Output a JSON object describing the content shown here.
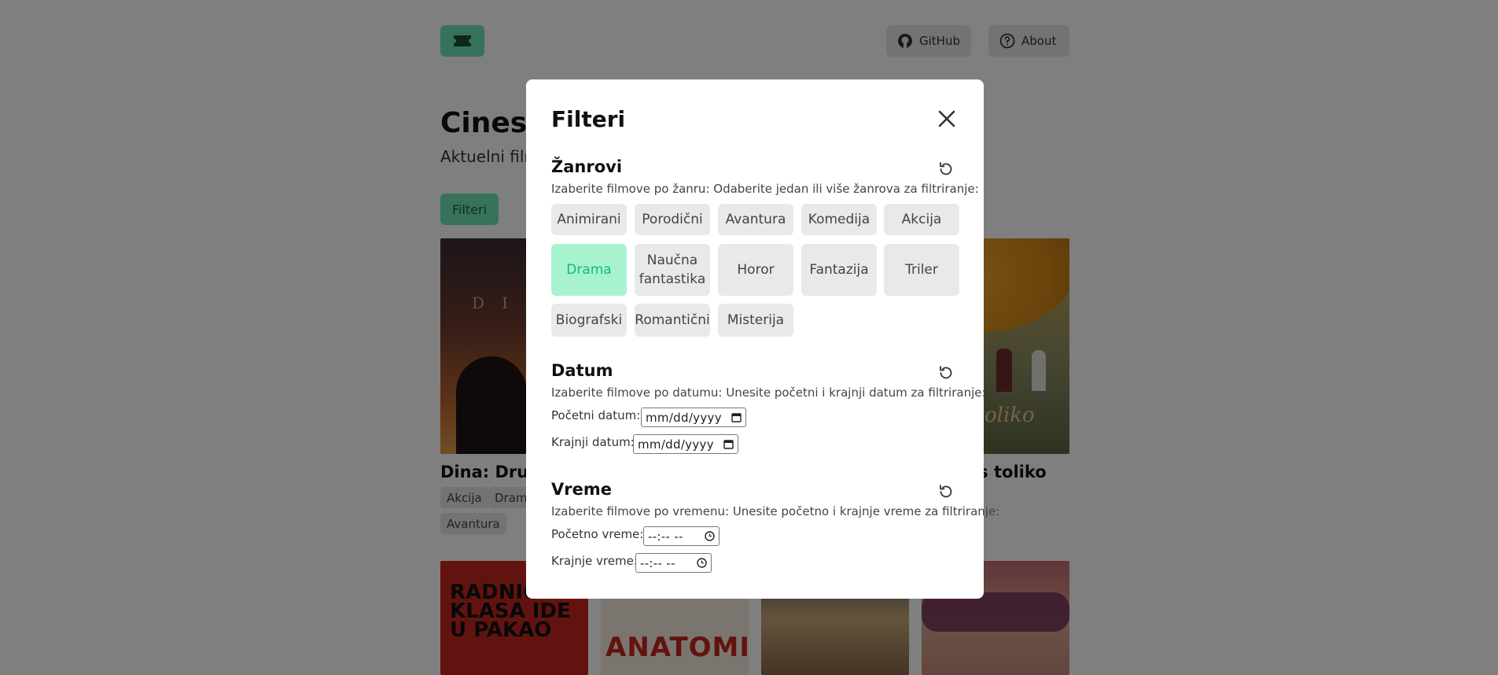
{
  "background": {
    "nav": {
      "github_label": "GitHub",
      "about_label": "About"
    },
    "page_title": "Cinesk",
    "page_subtitle": "Aktuelni film",
    "filter_button_label": "Filteri",
    "movies": [
      {
        "title": "Dina: Drugi",
        "tags": [
          "Akcija",
          "Dram",
          "Avantura"
        ]
      },
      {
        "title": "as toliko"
      }
    ],
    "poster_texts": {
      "radnicka": "RADNIČKA KLASA IDE U PAKAO",
      "anatomija": "ANATOMIJA",
      "ras": "ras toliko"
    }
  },
  "modal": {
    "title": "Filteri",
    "genres_section": {
      "title": "Žanrovi",
      "description": "Izaberite filmove po žanru: Odaberite jedan ili više žanrova za filtriranje:",
      "items": [
        {
          "label": "Animirani",
          "selected": false
        },
        {
          "label": "Porodični",
          "selected": false
        },
        {
          "label": "Avantura",
          "selected": false
        },
        {
          "label": "Komedija",
          "selected": false
        },
        {
          "label": "Akcija",
          "selected": false
        },
        {
          "label": "Drama",
          "selected": true
        },
        {
          "label": "Naučna fantastika",
          "selected": false
        },
        {
          "label": "Horor",
          "selected": false
        },
        {
          "label": "Fantazija",
          "selected": false
        },
        {
          "label": "Triler",
          "selected": false
        },
        {
          "label": "Biografski",
          "selected": false
        },
        {
          "label": "Romantični",
          "selected": false
        },
        {
          "label": "Misterija",
          "selected": false
        }
      ]
    },
    "date_section": {
      "title": "Datum",
      "description": "Izaberite filmove po datumu: Unesite početni i krajnji datum za filtriranje:",
      "start_label": "Početni datum:",
      "start_placeholder": "mm/dd/yyyy",
      "end_label": "Krajnji datum:",
      "end_placeholder": "mm/dd/yyyy"
    },
    "time_section": {
      "title": "Vreme",
      "description": "Izaberite filmove po vremenu: Unesite početno i krajnje vreme za filtriranje:",
      "start_label": "Početno vreme:",
      "start_placeholder": "--:-- --",
      "end_label": "Krajnje vreme:",
      "end_placeholder": "--:-- --"
    }
  },
  "colors": {
    "accent_green": "#6ee7b7",
    "selected_bg": "#a7f3d0",
    "selected_text": "#10b981",
    "chip_bg": "#e9e9ea"
  }
}
